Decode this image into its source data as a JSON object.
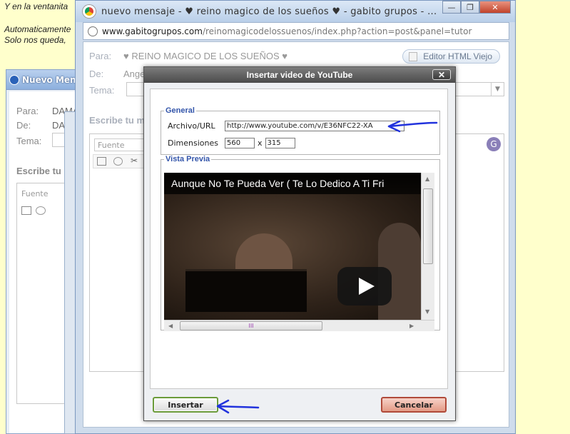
{
  "background": {
    "line1": "Y en la ventanita",
    "line2": "Automaticamente",
    "line3": "Solo nos queda,"
  },
  "back_window": {
    "title": "Nuevo Mensaje",
    "para_label": "Para:",
    "para_value": "DAMA",
    "de_label": "De:",
    "de_value": "DAMA",
    "tema_label": "Tema:",
    "escribe_label": "Escribe tu m",
    "fuente_placeholder": "Fuente"
  },
  "chrome": {
    "title": "nuevo mensaje - ♥ reino magico de los sueños ♥ - gabito grupos - ...",
    "url_domain": "www.gabitogrupos.com",
    "url_path": "/reinomagicodelossuenos/index.php?action=post&panel=tutor",
    "minimize": "—",
    "restore": "❐",
    "close": "✕"
  },
  "page": {
    "para_label": "Para:",
    "para_value": "♥ REINO MAGICO DE LOS SUEÑOS ♥",
    "de_label": "De:",
    "de_value": "Angel",
    "tema_label": "Tema:",
    "escribe_label": "Escribe tu m",
    "fuente_placeholder": "Fuente",
    "editor_button": "Editor HTML Viejo",
    "avatar_letter": "G"
  },
  "dialog": {
    "title": "Insertar video de YouTube",
    "close": "✕",
    "general_legend": "General",
    "url_label": "Archivo/URL",
    "url_value": "http://www.youtube.com/v/E36NFC22-XA",
    "dims_label": "Dimensiones",
    "width_value": "560",
    "times": "x",
    "height_value": "315",
    "preview_legend": "Vista Previa",
    "video_title": "Aunque No Te Pueda Ver ( Te Lo Dedico A Ti Fri",
    "scroll_grip": "III",
    "insert_button": "Insertar",
    "cancel_button": "Cancelar"
  },
  "colors": {
    "annotation_arrow": "#2233dd",
    "insert_border": "#6b9b3a",
    "cancel_border": "#b04a3a"
  }
}
